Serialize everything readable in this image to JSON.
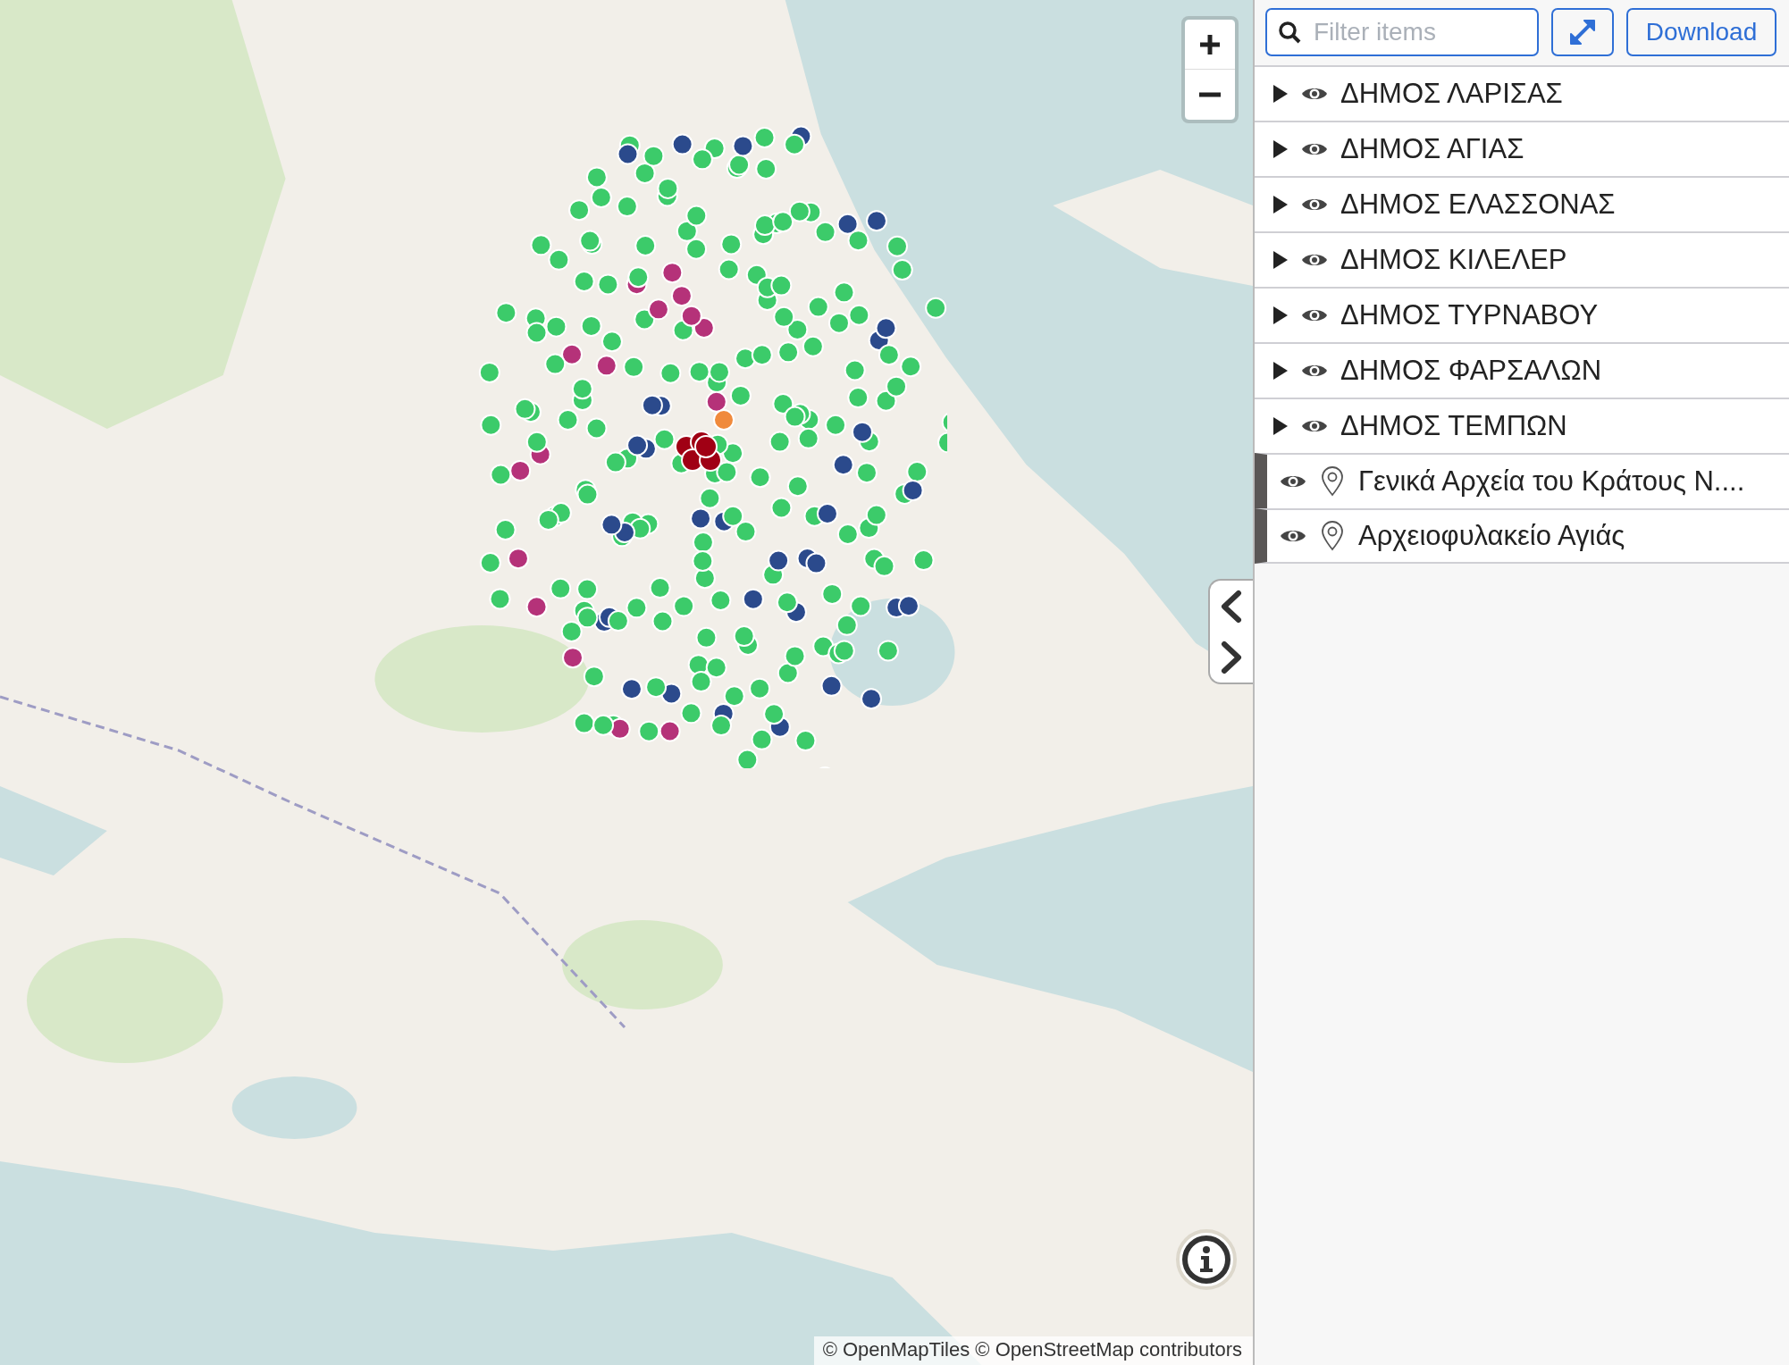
{
  "map": {
    "attribution": "© OpenMapTiles © OpenStreetMap contributors"
  },
  "toolbar": {
    "search": {
      "placeholder": "Filter items"
    },
    "download_button": "Download"
  },
  "tree": [
    {
      "kind": "group",
      "label": "ΔΗΜΟΣ ΛΑΡΙΣΑΣ",
      "expanded": false,
      "visible": true
    },
    {
      "kind": "group",
      "label": "ΔΗΜΟΣ ΑΓΙΑΣ",
      "expanded": false,
      "visible": true
    },
    {
      "kind": "group",
      "label": "ΔΗΜΟΣ ΕΛΑΣΣΟΝΑΣ",
      "expanded": false,
      "visible": true
    },
    {
      "kind": "group",
      "label": "ΔΗΜΟΣ ΚΙΛΕΛΕΡ",
      "expanded": false,
      "visible": true
    },
    {
      "kind": "group",
      "label": "ΔΗΜΟΣ ΤΥΡΝΑΒΟΥ",
      "expanded": false,
      "visible": true
    },
    {
      "kind": "group",
      "label": "ΔΗΜΟΣ ΦΑΡΣΑΛΩΝ",
      "expanded": false,
      "visible": true
    },
    {
      "kind": "group",
      "label": "ΔΗΜΟΣ ΤΕΜΠΩΝ",
      "expanded": false,
      "visible": true
    },
    {
      "kind": "place",
      "label": "Γενικά Αρχεία του Κράτους Ν....",
      "visible": true
    },
    {
      "kind": "place",
      "label": "Αρχειοφυλακείο Αγιάς",
      "visible": true
    }
  ]
}
